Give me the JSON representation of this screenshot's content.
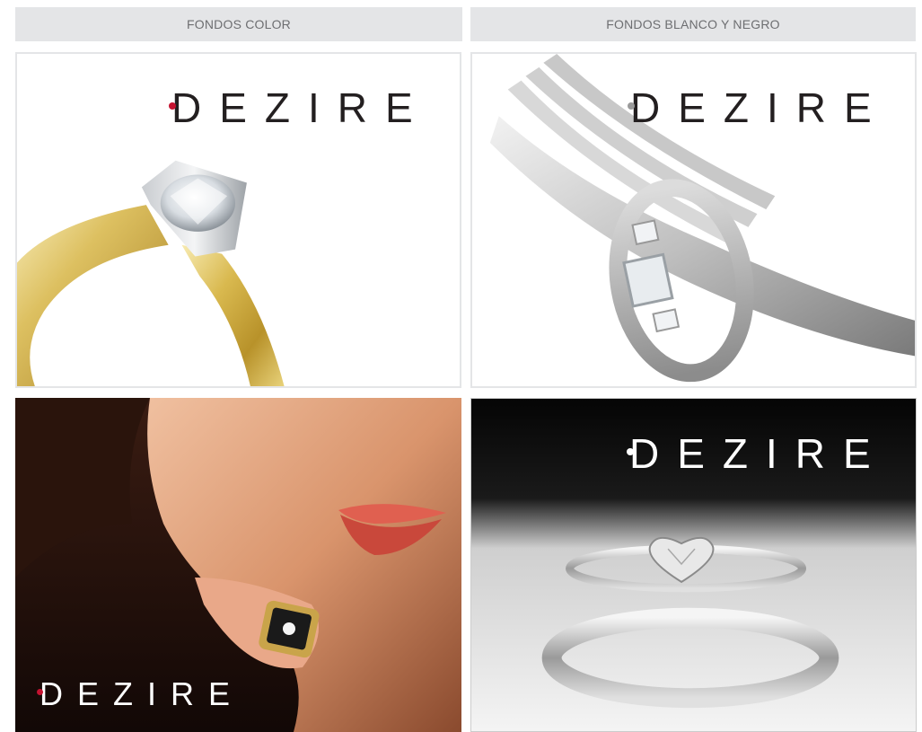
{
  "headers": {
    "color": "FONDOS COLOR",
    "bw": "FONDOS BLANCO Y NEGRO"
  },
  "panels": [
    {
      "logo": "DEZIRE",
      "theme": "color-white"
    },
    {
      "logo": "DEZIRE",
      "theme": "bw-white"
    },
    {
      "logo": "DEZIRE",
      "theme": "color-dark"
    },
    {
      "logo": "DEZIRE",
      "theme": "bw-dark"
    }
  ],
  "colors": {
    "header_bg": "#e4e5e7",
    "header_text": "#6d6e71",
    "brand_dot": "#c41230",
    "logo_dark": "#231f20"
  }
}
